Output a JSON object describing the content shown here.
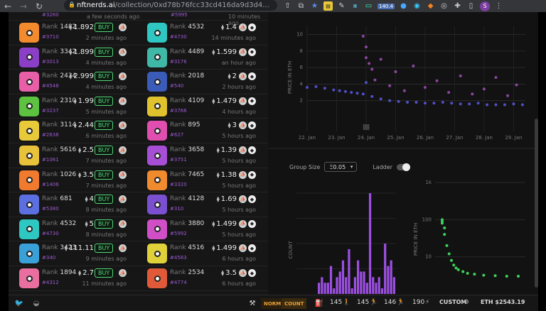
{
  "browser": {
    "url_host": "nftnerds.ai",
    "url_path": "/collection/0xd78b76fcc33cd416da9d3d4...",
    "extension_badge": "140.4",
    "profile_initial": "S"
  },
  "top_partial": {
    "left_id": "#3280",
    "left_ago": "a few seconds ago",
    "right_id": "#5995",
    "right_ago": "10 minutes ago"
  },
  "listings": [
    {
      "left": {
        "rank": "1482",
        "id": "#3710",
        "price": "1.892",
        "buy": "BUY",
        "ago": "2 minutes ago",
        "color": "#f28a2e"
      },
      "right": {
        "rank": "4532",
        "id": "#4730",
        "price": "1.4",
        "ago": "14 minutes ago",
        "color": "#2ec7c1"
      }
    },
    {
      "left": {
        "rank": "3342",
        "id": "#3013",
        "price": "1.899",
        "buy": "BUY",
        "ago": "4 minutes ago",
        "color": "#8a3fc6"
      },
      "right": {
        "rank": "4489",
        "id": "#3176",
        "price": "1.599",
        "ago": "an hour ago",
        "color": "#3fb8a8"
      }
    },
    {
      "left": {
        "rank": "2434",
        "id": "#4548",
        "price": "2.999",
        "buy": "BUY",
        "ago": "4 minutes ago",
        "color": "#e85fa8"
      },
      "right": {
        "rank": "2018",
        "id": "#540",
        "price": "2",
        "ago": "2 hours ago",
        "color": "#3a5bb8"
      }
    },
    {
      "left": {
        "rank": "2310",
        "id": "#3237",
        "price": "1.99",
        "buy": "BUY",
        "ago": "5 minutes ago",
        "color": "#5cc23f"
      },
      "right": {
        "rank": "4109",
        "id": "#3766",
        "price": "1.479",
        "ago": "4 hours ago",
        "color": "#e0c22e"
      }
    },
    {
      "left": {
        "rank": "3114",
        "id": "#2638",
        "price": "2.44",
        "buy": "BUY",
        "ago": "6 minutes ago",
        "color": "#e8c93a"
      },
      "right": {
        "rank": "895",
        "id": "#627",
        "price": "3",
        "ago": "5 hours ago",
        "color": "#e04fb0"
      }
    },
    {
      "left": {
        "rank": "5616",
        "id": "#1061",
        "price": "2.5",
        "buy": "BUY",
        "ago": "7 minutes ago",
        "color": "#e8c23a"
      },
      "right": {
        "rank": "3658",
        "id": "#3751",
        "price": "1.39",
        "ago": "5 hours ago",
        "color": "#a64fd6"
      }
    },
    {
      "left": {
        "rank": "1026",
        "id": "#1406",
        "price": "3.5",
        "buy": "BUY",
        "ago": "7 minutes ago",
        "color": "#f07a2e"
      },
      "right": {
        "rank": "7465",
        "id": "#3320",
        "price": "1.38",
        "ago": "5 hours ago",
        "color": "#f08a2e"
      }
    },
    {
      "left": {
        "rank": "681",
        "id": "#5380",
        "price": "4",
        "buy": "BUY",
        "ago": "8 minutes ago",
        "color": "#5b6fe0"
      },
      "right": {
        "rank": "4128",
        "id": "#310",
        "price": "1.69",
        "ago": "5 hours ago",
        "color": "#7a4fd0"
      }
    },
    {
      "left": {
        "rank": "4532",
        "id": "#4730",
        "price": "5",
        "buy": "BUY",
        "ago": "8 minutes ago",
        "color": "#2ec7c1"
      },
      "right": {
        "rank": "3880",
        "id": "#5992",
        "price": "1.499",
        "ago": "5 hours ago",
        "color": "#d04fc6"
      }
    },
    {
      "left": {
        "rank": "3423",
        "id": "#340",
        "price": "111.11",
        "buy": "BUY",
        "ago": "9 minutes ago",
        "color": "#3aa0d8"
      },
      "right": {
        "rank": "4516",
        "id": "#4583",
        "price": "1.499",
        "ago": "6 hours ago",
        "color": "#e0d03a"
      }
    },
    {
      "left": {
        "rank": "1894",
        "id": "#4312",
        "price": "2.7",
        "buy": "BUY",
        "ago": "11 minutes ago",
        "color": "#e86fa0"
      },
      "right": {
        "rank": "2534",
        "id": "#4774",
        "price": "3.5",
        "ago": "6 hours ago",
        "color": "#e05a3a"
      }
    }
  ],
  "rank_label": "Rank",
  "controls": {
    "group_size_label": "Group Size",
    "group_size_value": "Ξ0.05",
    "ladder_label": "Ladder"
  },
  "footer": {
    "tag_norm": "NORM",
    "tag_count": "COUNT",
    "gas_1": "145",
    "gas_2": "145",
    "gas_3": "146",
    "gas_4": "190",
    "custom": "CUSTOM",
    "eth_price": "ETH $2543.19"
  },
  "chart_data": [
    {
      "type": "scatter",
      "ylabel": "PRICE IN ETH",
      "yticks": [
        "2",
        "4",
        "6",
        "8",
        "10"
      ],
      "xticks": [
        "22. Jan",
        "23. Jan",
        "24. Jan",
        "25. Jan",
        "26. Jan",
        "27. Jan",
        "28. Jan",
        "29. Jan"
      ],
      "series": [
        {
          "color": "#5a5ae6",
          "x": [
            22.0,
            22.3,
            22.6,
            22.9,
            23.1,
            23.3,
            23.5,
            23.7,
            23.9,
            24.0,
            24.2,
            24.5,
            24.8,
            25.1,
            25.4,
            25.7,
            26.0,
            26.3,
            26.6,
            26.9,
            27.2,
            27.5,
            27.8,
            28.1,
            28.4,
            28.7,
            29.0,
            29.3
          ],
          "y": [
            3.6,
            3.7,
            3.5,
            3.3,
            3.2,
            3.1,
            3.0,
            2.9,
            2.8,
            4.2,
            2.5,
            2.2,
            2.0,
            1.9,
            1.8,
            1.8,
            1.7,
            1.7,
            1.8,
            1.7,
            1.6,
            1.6,
            1.7,
            1.5,
            1.5,
            1.5,
            1.6,
            1.5
          ]
        },
        {
          "color": "#a04fb8",
          "x": [
            23.9,
            24.0,
            24.0,
            24.1,
            24.2,
            24.3,
            24.5,
            24.8,
            25.0,
            25.3,
            25.6,
            26.0,
            26.4,
            26.8,
            27.2,
            27.6,
            28.0,
            28.4,
            28.8,
            29.1
          ],
          "y": [
            9.8,
            8.5,
            7.2,
            6.5,
            5.8,
            4.5,
            7.0,
            3.8,
            5.5,
            3.2,
            6.2,
            3.6,
            4.4,
            3.0,
            5.0,
            2.8,
            3.4,
            4.8,
            2.6,
            3.9
          ]
        }
      ]
    },
    {
      "type": "bar",
      "ylabel": "COUNT",
      "values": [
        2,
        3,
        2,
        2,
        5,
        1,
        3,
        4,
        6,
        3,
        8,
        1,
        3,
        6,
        4,
        4,
        2,
        18,
        3,
        2,
        3,
        1,
        9,
        5,
        6,
        3
      ]
    },
    {
      "type": "scatter",
      "ylabel": "PRICE IN ETH",
      "log_scale": true,
      "yticks": [
        "10",
        "100",
        "1k"
      ],
      "series": [
        {
          "color": "#3fd05a",
          "x": [
            0,
            0,
            0,
            1,
            1,
            2,
            3,
            4,
            5,
            6,
            7,
            9,
            11,
            14,
            18,
            23,
            28,
            33
          ],
          "y": [
            100,
            90,
            80,
            60,
            40,
            20,
            12,
            8,
            6,
            5,
            4.5,
            4,
            3.6,
            3.4,
            3.2,
            3.1,
            3,
            3
          ]
        }
      ]
    }
  ]
}
